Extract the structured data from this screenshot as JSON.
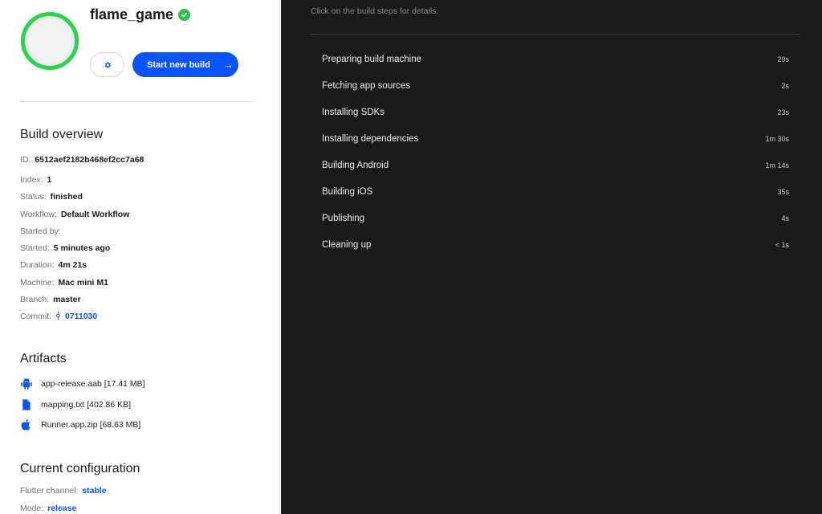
{
  "app": {
    "name": "flame_game",
    "start_button": "Start new build",
    "start_arrow": "→"
  },
  "overview": {
    "title": "Build overview",
    "fields": [
      {
        "label": "ID:",
        "value": "6512aef2182b468ef2cc7a68"
      },
      {
        "label": "Index:",
        "value": "1"
      },
      {
        "label": "Status:",
        "value": "finished"
      },
      {
        "label": "Workflow:",
        "value": "Default Workflow"
      },
      {
        "label": "Started by:",
        "value": ""
      },
      {
        "label": "Started:",
        "value": "5 minutes ago"
      },
      {
        "label": "Duration:",
        "value": "4m 21s"
      },
      {
        "label": "Machine:",
        "value": "Mac mini M1"
      },
      {
        "label": "Branch:",
        "value": "master"
      },
      {
        "label": "Commit:",
        "value": "0711030",
        "icon": "commit-icon"
      }
    ]
  },
  "artifacts": {
    "title": "Artifacts",
    "items": [
      {
        "name": "app-release.aab [17.41 MB]",
        "icon": "android-icon"
      },
      {
        "name": "mapping.txt [402.86 KB]",
        "icon": "file-icon"
      },
      {
        "name": "Runner.app.zip [68.63 MB]",
        "icon": "apple-icon"
      }
    ]
  },
  "config": {
    "title": "Current configuration",
    "fields": [
      {
        "label": "Flutter channel:",
        "value": "stable"
      },
      {
        "label": "Mode:",
        "value": "release"
      }
    ]
  },
  "steps_panel": {
    "hint": "Click on the build steps for details.",
    "steps": [
      {
        "label": "Preparing build machine",
        "duration": "29s"
      },
      {
        "label": "Fetching app sources",
        "duration": "2s"
      },
      {
        "label": "Installing SDKs",
        "duration": "23s"
      },
      {
        "label": "Installing dependencies",
        "duration": "1m 30s"
      },
      {
        "label": "Building Android",
        "duration": "1m 14s"
      },
      {
        "label": "Building iOS",
        "duration": "35s"
      },
      {
        "label": "Publishing",
        "duration": "4s"
      },
      {
        "label": "Cleaning up",
        "duration": "< 1s"
      }
    ]
  },
  "colors": {
    "accent": "#0a54ff",
    "success": "#2bd34f",
    "panel_dark": "#1a1a1a"
  }
}
